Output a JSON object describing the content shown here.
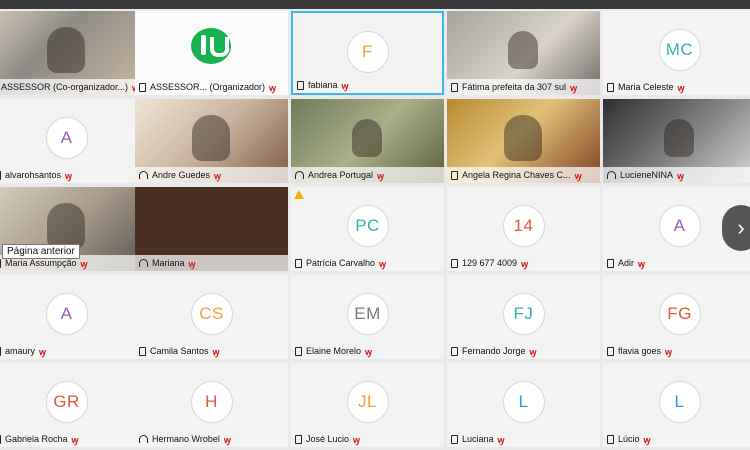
{
  "tooltip": "Página anterior",
  "next_icon": "›",
  "participants": [
    {
      "name": "ASSESSOR (Co-organizador...)",
      "initials": "",
      "icon": "device-icon",
      "photo": "photo-a"
    },
    {
      "name": "ASSESSOR... (Organizador)",
      "initials": "",
      "icon": "device-icon",
      "logo": "yes"
    },
    {
      "name": "fabiana",
      "initials": "F",
      "icon": "device-icon",
      "active": true
    },
    {
      "name": "Fátima prefeita da 307 sul",
      "initials": "",
      "icon": "device-icon",
      "photo": "photo-b"
    },
    {
      "name": "Maria Celeste",
      "initials": "MC",
      "icon": "device-icon"
    },
    {
      "name": "alvarohsantos",
      "initials": "A",
      "icon": "device-icon"
    },
    {
      "name": "Andre Guedes",
      "initials": "",
      "icon": "headphone-icon",
      "photo": "photo-c"
    },
    {
      "name": "Andrea Portugal",
      "initials": "",
      "icon": "headphone-icon",
      "photo": "photo-d"
    },
    {
      "name": "Angela Regina Chaves C...",
      "initials": "",
      "icon": "device-icon",
      "photo": "photo-e"
    },
    {
      "name": "LucieneNINA",
      "initials": "",
      "icon": "headphone-icon",
      "photo": "photo-f"
    },
    {
      "name": "Maria Assumpção",
      "initials": "",
      "icon": "device-icon",
      "photo": "photo-g"
    },
    {
      "name": "Mariana",
      "initials": "",
      "icon": "headphone-icon",
      "dark": true
    },
    {
      "name": "Patrícia Carvalho",
      "initials": "PC",
      "icon": "device-icon",
      "warning": true
    },
    {
      "name": "129 677 4009",
      "initials": "14",
      "icon": "device-icon"
    },
    {
      "name": "Adir",
      "initials": "A",
      "icon": "device-icon"
    },
    {
      "name": "amaury",
      "initials": "A",
      "icon": "device-icon"
    },
    {
      "name": "Camila Santos",
      "initials": "CS",
      "icon": "device-icon"
    },
    {
      "name": "Elaine Morelo",
      "initials": "EM",
      "icon": "device-icon"
    },
    {
      "name": "Fernando Jorge",
      "initials": "FJ",
      "icon": "device-icon"
    },
    {
      "name": "flavia goes",
      "initials": "FG",
      "icon": "device-icon"
    },
    {
      "name": "Gabriela Rocha",
      "initials": "GR",
      "icon": "device-icon"
    },
    {
      "name": "Hermano Wrobel",
      "initials": "H",
      "icon": "headphone-icon"
    },
    {
      "name": "José Lucio",
      "initials": "JL",
      "icon": "device-icon"
    },
    {
      "name": "Luciana",
      "initials": "L",
      "icon": "device-icon"
    },
    {
      "name": "Lúcio",
      "initials": "L",
      "icon": "device-icon"
    }
  ],
  "colors": {
    "F": "#f0a23c",
    "MC": "#35b3a8",
    "A": "#9f5db8",
    "PC": "#35b3a8",
    "14": "#e2573b",
    "CS": "#f0a23c",
    "EM": "#7a7a7a",
    "FJ": "#35b3a8",
    "FG": "#e2573b",
    "GR": "#e2573b",
    "H": "#e2573b",
    "JL": "#f0a23c",
    "L": "#2d97d8"
  }
}
